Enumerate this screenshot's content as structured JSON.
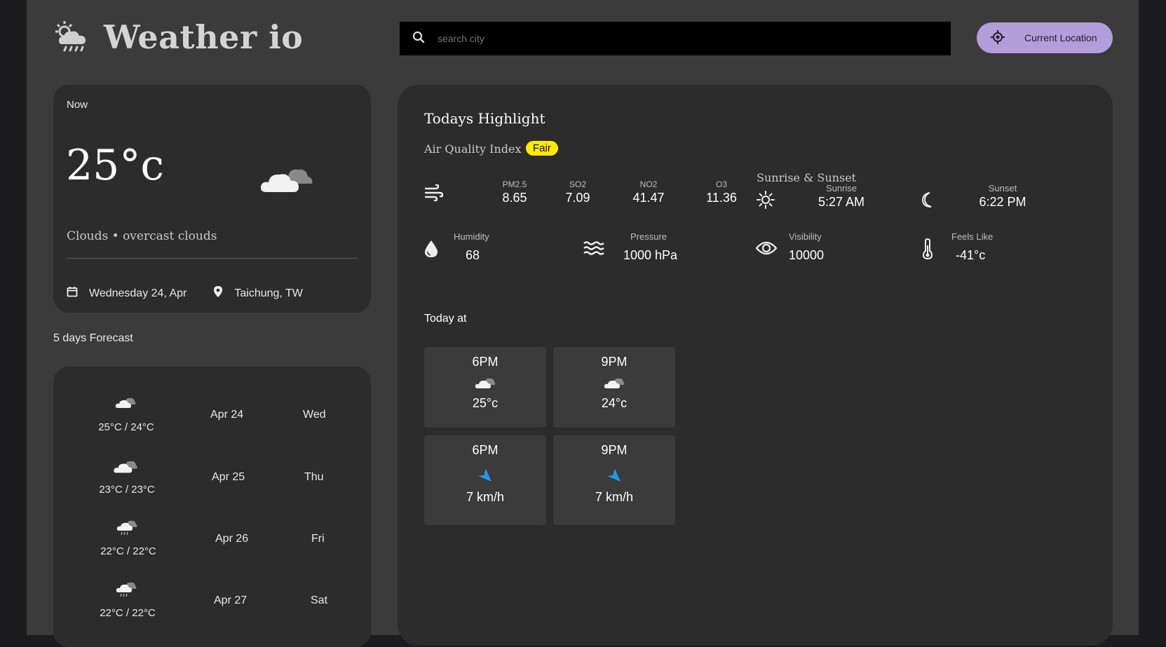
{
  "header": {
    "app_title": "Weather io",
    "logo_icon": "cloud-sun-rain-icon",
    "search_placeholder": "search city",
    "current_location_label": "Current Location"
  },
  "now": {
    "label": "Now",
    "temperature": "25°c",
    "icon": "overcast-clouds-icon",
    "description": "Clouds • overcast clouds",
    "date": "Wednesday 24, Apr",
    "location": "Taichung, TW"
  },
  "forecast": {
    "title": "5 days Forecast",
    "days": [
      {
        "temps": "25°C / 24°C",
        "date": "Apr 24",
        "day": "Wed",
        "icon": "overcast-clouds-icon"
      },
      {
        "temps": "23°C / 23°C",
        "date": "Apr 25",
        "day": "Thu",
        "icon": "overcast-clouds-icon"
      },
      {
        "temps": "22°C / 22°C",
        "date": "Apr 26",
        "day": "Fri",
        "icon": "rain-cloud-icon"
      },
      {
        "temps": "22°C / 22°C",
        "date": "Apr 27",
        "day": "Sat",
        "icon": "rain-cloud-icon"
      }
    ]
  },
  "highlights": {
    "title": "Todays Highlight",
    "aqi_label": "Air Quality Index",
    "aqi_badge": "Fair",
    "aqi_badge_color": "#ffea00",
    "pollutants": [
      {
        "key": "PM2.5",
        "value": "8.65"
      },
      {
        "key": "SO2",
        "value": "7.09"
      },
      {
        "key": "NO2",
        "value": "41.47"
      },
      {
        "key": "O3",
        "value": "11.36"
      }
    ],
    "sun_title": "Sunrise & Sunset",
    "sunrise_label": "Sunrise",
    "sunrise": "5:27 AM",
    "sunset_label": "Sunset",
    "sunset": "6:22 PM",
    "humidity_label": "Humidity",
    "humidity": "68",
    "pressure_label": "Pressure",
    "pressure": "1000 hPa",
    "visibility_label": "Visibility",
    "visibility": "10000",
    "feels_label": "Feels Like",
    "feels": "-41°c"
  },
  "today": {
    "title": "Today at",
    "temps": [
      {
        "time": "6PM",
        "value": "25°c",
        "icon": "overcast-clouds-icon"
      },
      {
        "time": "9PM",
        "value": "24°c",
        "icon": "overcast-clouds-icon"
      }
    ],
    "winds": [
      {
        "time": "6PM",
        "value": "7 km/h",
        "icon": "wind-direction-icon"
      },
      {
        "time": "9PM",
        "value": "7 km/h",
        "icon": "wind-direction-icon"
      }
    ]
  },
  "colors": {
    "accent": "#b39ddb",
    "card": "#2c2c2c",
    "page": "#3b3b3b",
    "wind_arrow": "#2196f3"
  }
}
